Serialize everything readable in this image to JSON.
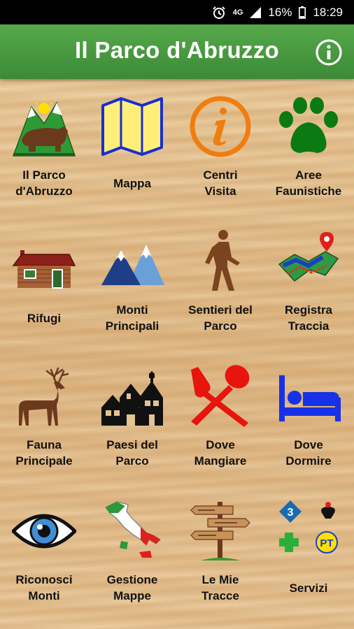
{
  "status_bar": {
    "network": "4G",
    "battery": "16%",
    "time": "18:29",
    "icons": [
      "alarm-icon",
      "signal-icon",
      "battery-icon"
    ]
  },
  "app_bar": {
    "title": "Il Parco d'Abruzzo",
    "info_icon": "info-icon"
  },
  "menu": [
    {
      "label": "Il Parco\nd'Abruzzo",
      "icon": "park-bear-icon"
    },
    {
      "label": "Mappa",
      "icon": "map-icon"
    },
    {
      "label": "Centri\nVisita",
      "icon": "info-circle-icon"
    },
    {
      "label": "Aree\nFaunistiche",
      "icon": "paw-icon"
    },
    {
      "label": "Rifugi",
      "icon": "hut-icon"
    },
    {
      "label": "Monti\nPrincipali",
      "icon": "mountains-icon"
    },
    {
      "label": "Sentieri del\nParco",
      "icon": "hiker-icon"
    },
    {
      "label": "Registra\nTraccia",
      "icon": "track-map-icon"
    },
    {
      "label": "Fauna\nPrincipale",
      "icon": "deer-icon"
    },
    {
      "label": "Paesi del\nParco",
      "icon": "village-icon"
    },
    {
      "label": "Dove\nMangiare",
      "icon": "fork-spoon-icon"
    },
    {
      "label": "Dove\nDormire",
      "icon": "bed-icon"
    },
    {
      "label": "Riconosci\nMonti",
      "icon": "eye-icon"
    },
    {
      "label": "Gestione\nMappe",
      "icon": "italy-map-icon"
    },
    {
      "label": "Le Mie\nTracce",
      "icon": "signpost-icon"
    },
    {
      "label": "Servizi",
      "icon": "services-icon",
      "service_badges": [
        "3",
        "PT"
      ]
    }
  ],
  "colors": {
    "app_bar": "#4a9c41",
    "status_bar": "#000000",
    "wood": "#e3c294"
  }
}
